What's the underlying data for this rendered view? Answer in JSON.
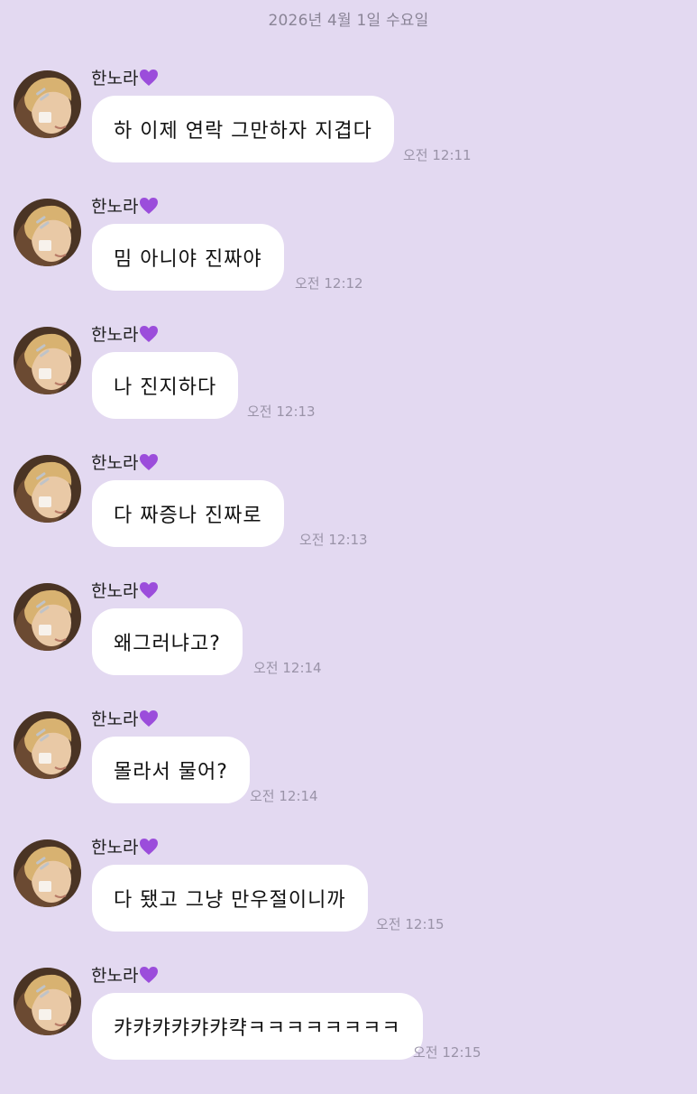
{
  "date_divider": "2026년 4월 1일 수요일",
  "colors": {
    "background": "#e3d9f1",
    "bubble": "#ffffff",
    "timestamp": "#9a93a8",
    "heart": "#9b4ddb"
  },
  "messages": [
    {
      "sender": "한노라",
      "sender_icon": "purple-heart-icon",
      "text": "하 이제 연락 그만하자 지겹다",
      "time": "오전 12:11"
    },
    {
      "sender": "한노라",
      "sender_icon": "purple-heart-icon",
      "text": "밈 아니야 진짜야",
      "time": "오전 12:12"
    },
    {
      "sender": "한노라",
      "sender_icon": "purple-heart-icon",
      "text": "나 진지하다",
      "time": "오전 12:13"
    },
    {
      "sender": "한노라",
      "sender_icon": "purple-heart-icon",
      "text": "다 짜증나 진짜로",
      "time": "오전 12:13"
    },
    {
      "sender": "한노라",
      "sender_icon": "purple-heart-icon",
      "text": "왜그러냐고?",
      "time": "오전 12:14"
    },
    {
      "sender": "한노라",
      "sender_icon": "purple-heart-icon",
      "text": "몰라서 물어?",
      "time": "오전 12:14"
    },
    {
      "sender": "한노라",
      "sender_icon": "purple-heart-icon",
      "text": "다 됐고 그냥 만우절이니까",
      "time": "오전 12:15"
    },
    {
      "sender": "한노라",
      "sender_icon": "purple-heart-icon",
      "text": "캬캬캬캬캬캬캭ㅋㅋㅋㅋㅋㅋㅋㅋ",
      "time": "오전 12:15"
    }
  ]
}
